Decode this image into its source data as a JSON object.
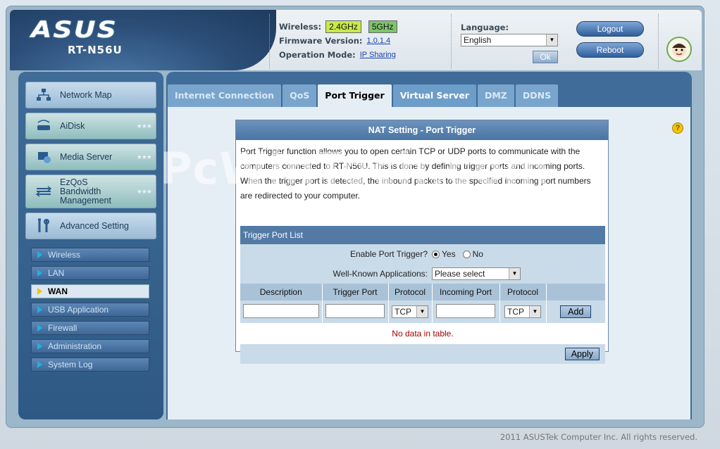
{
  "header": {
    "brand": "ASUS",
    "model": "RT-N56U",
    "wireless_label": "Wireless:",
    "band_24": "2.4GHz",
    "band_5": "5GHz",
    "firmware_label": "Firmware Version:",
    "firmware_value": "1.0.1.4",
    "opmode_label": "Operation Mode:",
    "opmode_value": "IP Sharing",
    "language_label": "Language:",
    "language_value": "English",
    "ok_label": "Ok",
    "logout_label": "Logout",
    "reboot_label": "Reboot"
  },
  "sidebar": {
    "main_items": [
      {
        "label": "Network Map",
        "icon": "network-icon"
      },
      {
        "label": "AiDisk",
        "icon": "disk-icon"
      },
      {
        "label": "Media Server",
        "icon": "media-icon"
      },
      {
        "label": "EzQoS Bandwidth Management",
        "label_lines": [
          "EzQoS",
          "Bandwidth",
          "Management"
        ],
        "icon": "qos-icon"
      },
      {
        "label": "Advanced Setting",
        "icon": "tools-icon"
      }
    ],
    "sub_items": [
      {
        "label": "Wireless",
        "active": false
      },
      {
        "label": "LAN",
        "active": false
      },
      {
        "label": "WAN",
        "active": true
      },
      {
        "label": "USB Application",
        "active": false
      },
      {
        "label": "Firewall",
        "active": false
      },
      {
        "label": "Administration",
        "active": false
      },
      {
        "label": "System Log",
        "active": false
      }
    ]
  },
  "tabs": [
    {
      "label": "Internet Connection",
      "active": false
    },
    {
      "label": "QoS",
      "active": false
    },
    {
      "label": "Port Trigger",
      "active": true
    },
    {
      "label": "Virtual Server",
      "active": false
    },
    {
      "label": "DMZ",
      "active": false
    },
    {
      "label": "DDNS",
      "active": false
    }
  ],
  "panel": {
    "title": "NAT Setting - Port Trigger",
    "description": "Port Trigger function allows you to open certain TCP or UDP ports to communicate with the computers connected to RT-N56U. This is done by defining trigger ports and incoming ports. When the trigger port is detected, the inbound packets to the specified incoming port numbers are redirected to your computer.",
    "watermark": "PcWinTech.com",
    "list_title": "Trigger Port List",
    "enable_label": "Enable Port Trigger?",
    "yes_label": "Yes",
    "no_label": "No",
    "enable_value": "Yes",
    "apps_label": "Well-Known Applications:",
    "apps_placeholder": "Please select",
    "columns": [
      "Description",
      "Trigger Port",
      "Protocol",
      "Incoming Port",
      "Protocol"
    ],
    "protocol_trigger": "TCP",
    "protocol_incoming": "TCP",
    "add_label": "Add",
    "empty_text": "No data in table.",
    "apply_label": "Apply"
  },
  "footer": "2011 ASUSTek Computer Inc. All rights reserved.",
  "colors": {
    "band_24": "#c7ea4a",
    "band_5": "#7fc46a",
    "empty_text": "#a40000",
    "accent": "#3f6c98"
  }
}
